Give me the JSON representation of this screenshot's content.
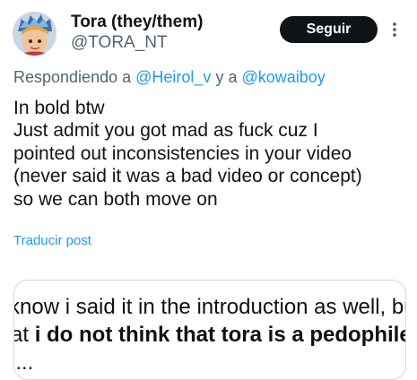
{
  "author": {
    "display_name": "Tora (they/them)",
    "handle": "@TORA_NT"
  },
  "follow_label": "Seguir",
  "reply": {
    "prefix": "Respondiendo a",
    "mention_1": "@Heirol_v",
    "conjunction": "y a",
    "mention_2": "@kowaiboy"
  },
  "tweet": {
    "lines": [
      "In bold btw",
      "Just admit you got mad as fuck cuz I",
      "pointed out inconsistencies in your video",
      "(never said it was a bad video or concept)",
      "so we can both move on"
    ]
  },
  "translate_label": "Traducir post",
  "media": {
    "line_1": "know i said it in the introduction as well, bu",
    "line_2_prefix": "at",
    "line_2_bold": "i do not think that tora is a pedophile",
    "line_3": "i..."
  },
  "colors": {
    "accent": "#1d9bf0",
    "text": "#0f1419",
    "secondary": "#536471",
    "follow_bg": "#0f1419"
  },
  "icons": {
    "more": "more-dots-icon",
    "avatar": "avatar"
  }
}
